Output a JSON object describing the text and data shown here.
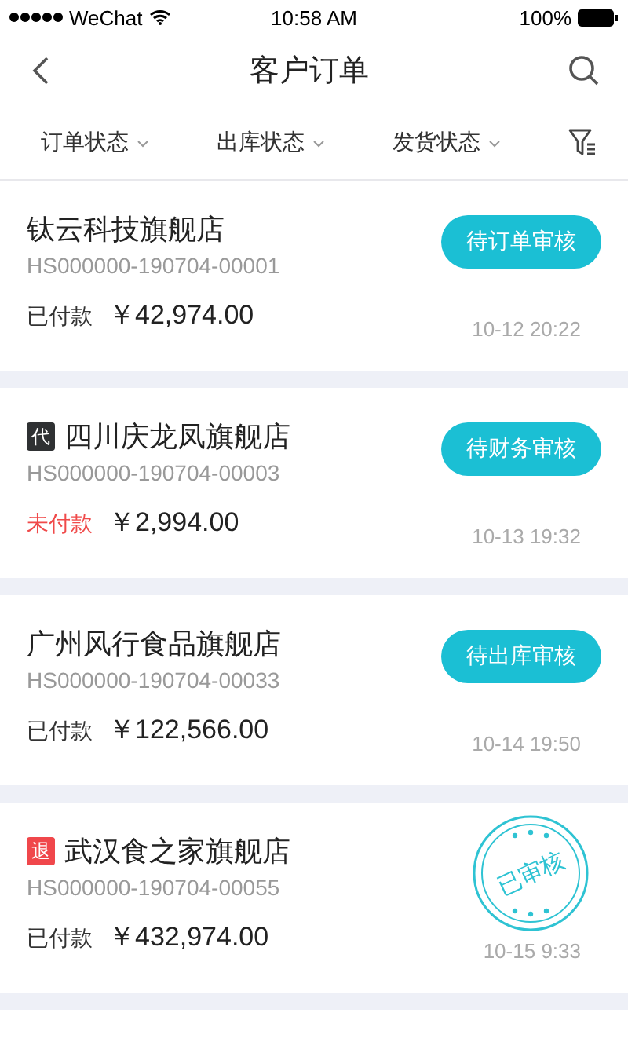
{
  "status_bar": {
    "carrier": "WeChat",
    "time": "10:58 AM",
    "battery": "100%"
  },
  "nav": {
    "title": "客户订单"
  },
  "filters": [
    {
      "label": "订单状态"
    },
    {
      "label": "出库状态"
    },
    {
      "label": "发货状态"
    }
  ],
  "orders": [
    {
      "shop": "钛云科技旗舰店",
      "number": "HS000000-190704-00001",
      "payment": "已付款",
      "paid": true,
      "amount": "￥42,974.00",
      "time": "10-12 20:22",
      "status": {
        "kind": "button",
        "label": "待订单审核"
      }
    },
    {
      "tag": {
        "kind": "agent",
        "label": "代"
      },
      "shop": "四川庆龙凤旗舰店",
      "number": "HS000000-190704-00003",
      "payment": "未付款",
      "paid": false,
      "amount": "￥2,994.00",
      "time": "10-13 19:32",
      "status": {
        "kind": "button",
        "label": "待财务审核"
      }
    },
    {
      "shop": "广州风行食品旗舰店",
      "number": "HS000000-190704-00033",
      "payment": "已付款",
      "paid": true,
      "amount": "￥122,566.00",
      "time": "10-14 19:50",
      "status": {
        "kind": "button",
        "label": "待出库审核"
      }
    },
    {
      "tag": {
        "kind": "refund",
        "label": "退"
      },
      "shop": "武汉食之家旗舰店",
      "number": "HS000000-190704-00055",
      "payment": "已付款",
      "paid": true,
      "amount": "￥432,974.00",
      "time": "10-15 9:33",
      "status": {
        "kind": "stamp",
        "label": "已审核"
      }
    }
  ]
}
